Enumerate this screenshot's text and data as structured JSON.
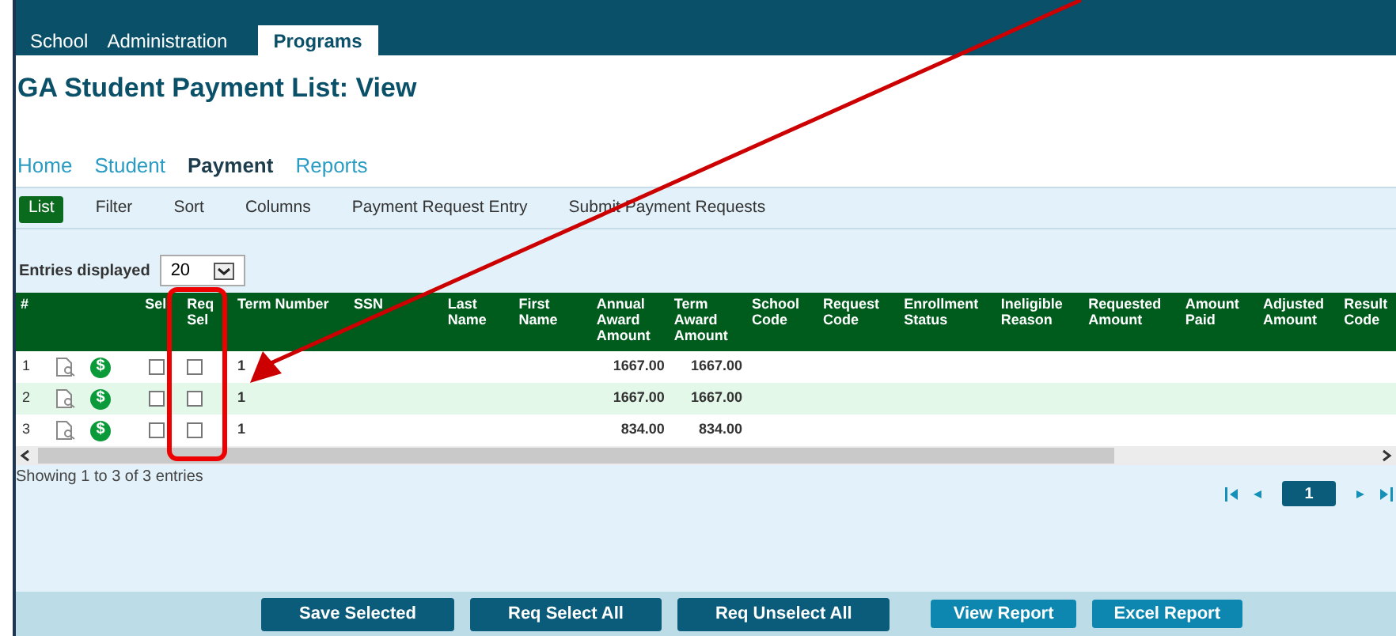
{
  "top_tabs": [
    {
      "label": "School",
      "selected": false
    },
    {
      "label": "Administration",
      "selected": false
    },
    {
      "label": "Programs",
      "selected": true
    }
  ],
  "title": "GA Student Payment List: View",
  "nav": [
    {
      "label": "Home",
      "selected": false
    },
    {
      "label": "Student",
      "selected": false
    },
    {
      "label": "Payment",
      "selected": true
    },
    {
      "label": "Reports",
      "selected": false
    }
  ],
  "toolbar": [
    {
      "label": "List",
      "selected": true
    },
    {
      "label": "Filter",
      "selected": false
    },
    {
      "label": "Sort",
      "selected": false
    },
    {
      "label": "Columns",
      "selected": false
    },
    {
      "label": "Payment Request Entry",
      "selected": false
    },
    {
      "label": "Submit Payment Requests",
      "selected": false
    }
  ],
  "entries": {
    "label": "Entries displayed",
    "value": "20"
  },
  "table": {
    "columns": [
      "#",
      "",
      "",
      "Sel",
      "Req Sel",
      "Term Number",
      "SSN",
      "Last Name",
      "First Name",
      "Annual Award Amount",
      "Term Award Amount",
      "School Code",
      "Request Code",
      "Enrollment Status",
      "Ineligible Reason",
      "Requested Amount",
      "Amount Paid",
      "Adjusted Amount",
      "Result Code"
    ],
    "rows": [
      {
        "num": "1",
        "pay_icon": "$",
        "sel": false,
        "req_sel": false,
        "term_number": "1",
        "annual": "1667.00",
        "term_award": "1667.00"
      },
      {
        "num": "2",
        "pay_icon": "$",
        "sel": false,
        "req_sel": false,
        "term_number": "1",
        "annual": "1667.00",
        "term_award": "1667.00"
      },
      {
        "num": "3",
        "pay_icon": "$",
        "sel": false,
        "req_sel": false,
        "term_number": "1",
        "annual": "834.00",
        "term_award": "834.00"
      }
    ]
  },
  "summary": "Showing 1 to 3 of 3 entries",
  "pager": {
    "page": "1"
  },
  "buttons": [
    {
      "label": "Save Selected",
      "kind": "dark"
    },
    {
      "label": "Req Select All",
      "kind": "dark"
    },
    {
      "label": "Req Unselect All",
      "kind": "dark"
    },
    {
      "label": "View Report",
      "kind": "light"
    },
    {
      "label": "Excel Report",
      "kind": "light"
    }
  ]
}
